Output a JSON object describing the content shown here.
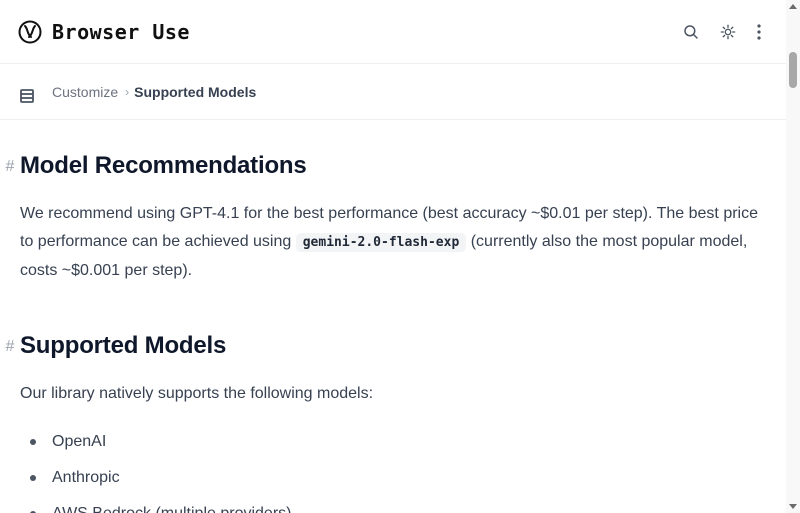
{
  "header": {
    "logo_text": "Browser Use",
    "logo_icon": "browser-use-logo-icon",
    "search_icon": "search-icon",
    "theme_icon": "theme-toggle-icon",
    "more_icon": "more-vertical-icon"
  },
  "breadcrumb": {
    "menu_icon": "menu-icon",
    "parent": "Customize",
    "separator": "›",
    "current": "Supported Models"
  },
  "sections": [
    {
      "heading": "Model Recommendations",
      "text_before": "We recommend using GPT-4.1 for the best performance (best accuracy ~$0.01 per step). The best price to performance can be achieved using ",
      "code": "gemini-2.0-flash-exp",
      "text_after": " (currently also the most popular model, costs ~$0.001 per step)."
    },
    {
      "heading": "Supported Models",
      "intro": "Our library natively supports the following models:",
      "items": [
        "OpenAI",
        "Anthropic",
        "AWS Bedrock (multiple providers)"
      ]
    }
  ],
  "anchor_icon": "link-icon",
  "colors": {
    "text": "#374151",
    "heading": "#0f172a",
    "code_bg": "#f3f4f6"
  }
}
